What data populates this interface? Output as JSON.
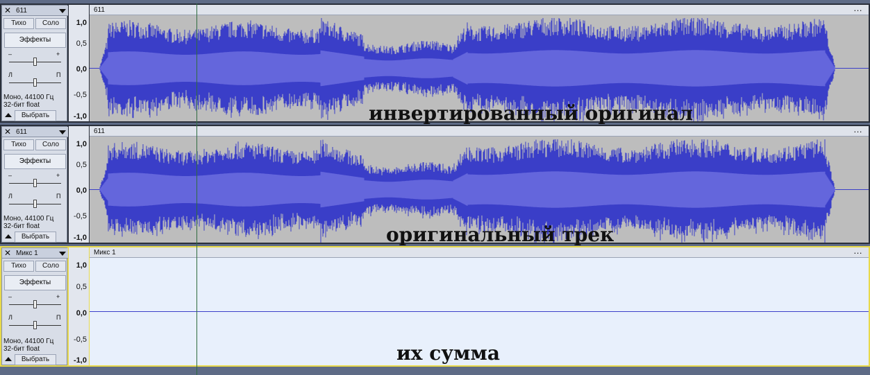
{
  "tracks": [
    {
      "name": "611",
      "clip_name": "611",
      "mute_label": "Тихо",
      "solo_label": "Соло",
      "effects_label": "Эффекты",
      "gain_minus": "–",
      "gain_plus": "+",
      "pan_left": "Л",
      "pan_right": "П",
      "info_line1": "Моно, 44100 Гц",
      "info_line2": "32-бит float",
      "select_label": "Выбрать",
      "scale": [
        "1,0",
        "0,5",
        "0,0",
        "-0,5",
        "-1,0"
      ],
      "overlay_caption": "инвертированный оригинал",
      "waveform": "inverted"
    },
    {
      "name": "611",
      "clip_name": "611",
      "mute_label": "Тихо",
      "solo_label": "Соло",
      "effects_label": "Эффекты",
      "gain_minus": "–",
      "gain_plus": "+",
      "pan_left": "Л",
      "pan_right": "П",
      "info_line1": "Моно, 44100 Гц",
      "info_line2": "32-бит float",
      "select_label": "Выбрать",
      "scale": [
        "1,0",
        "0,5",
        "0,0",
        "-0,5",
        "-1,0"
      ],
      "overlay_caption": "оригинальный трек",
      "waveform": "original"
    },
    {
      "name": "Микс 1",
      "clip_name": "Микс 1",
      "mute_label": "Тихо",
      "solo_label": "Соло",
      "effects_label": "Эффекты",
      "gain_minus": "–",
      "gain_plus": "+",
      "pan_left": "Л",
      "pan_right": "П",
      "info_line1": "Моно, 44100 Гц",
      "info_line2": "32-бит float",
      "select_label": "Выбрать",
      "scale": [
        "1,0",
        "0,5",
        "0,0",
        "-0,5",
        "-1,0"
      ],
      "overlay_caption": "их сумма",
      "waveform": "silent"
    }
  ],
  "colors": {
    "wave_peak": "#3a3ec8",
    "wave_rms": "#6466dc",
    "wave_bg": "#bdbdbd",
    "mix_bg": "#e8f0fc",
    "selected_border": "#e8d94a"
  }
}
